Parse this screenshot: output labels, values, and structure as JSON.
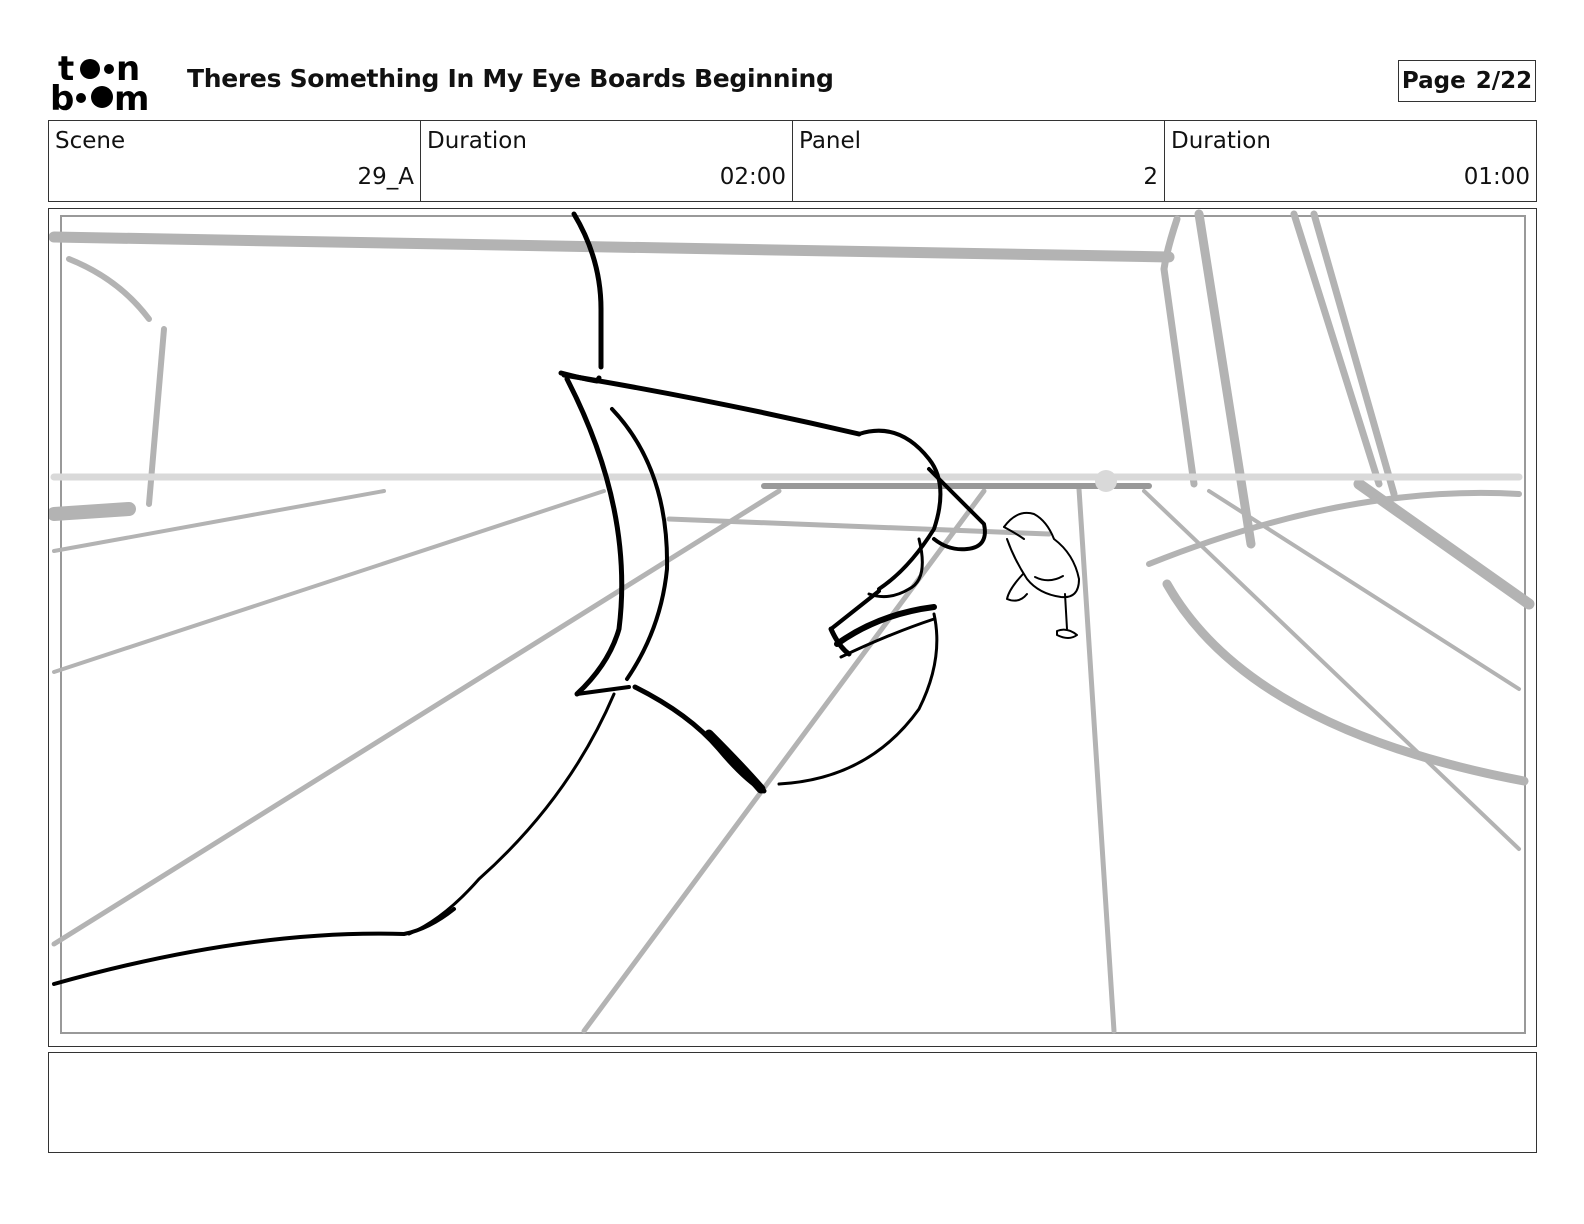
{
  "header": {
    "logo": {
      "line1": "toon",
      "line2": "boom",
      "icon": "toon-boom-logo"
    },
    "title": "Theres Something In My Eye Boards Beginning",
    "page_label": "Page",
    "page_value": "2/22"
  },
  "info": {
    "scene_label": "Scene",
    "scene_value": "29_A",
    "scene_duration_label": "Duration",
    "scene_duration_value": "02:00",
    "panel_label": "Panel",
    "panel_value": "2",
    "panel_duration_label": "Duration",
    "panel_duration_value": "01:00"
  },
  "panel": {
    "image": "storyboard-sketch",
    "colors": {
      "ink": "#000000",
      "guide": "#b3b3b3",
      "guide_light": "#d9d9d9"
    }
  },
  "notes": {
    "text": ""
  }
}
